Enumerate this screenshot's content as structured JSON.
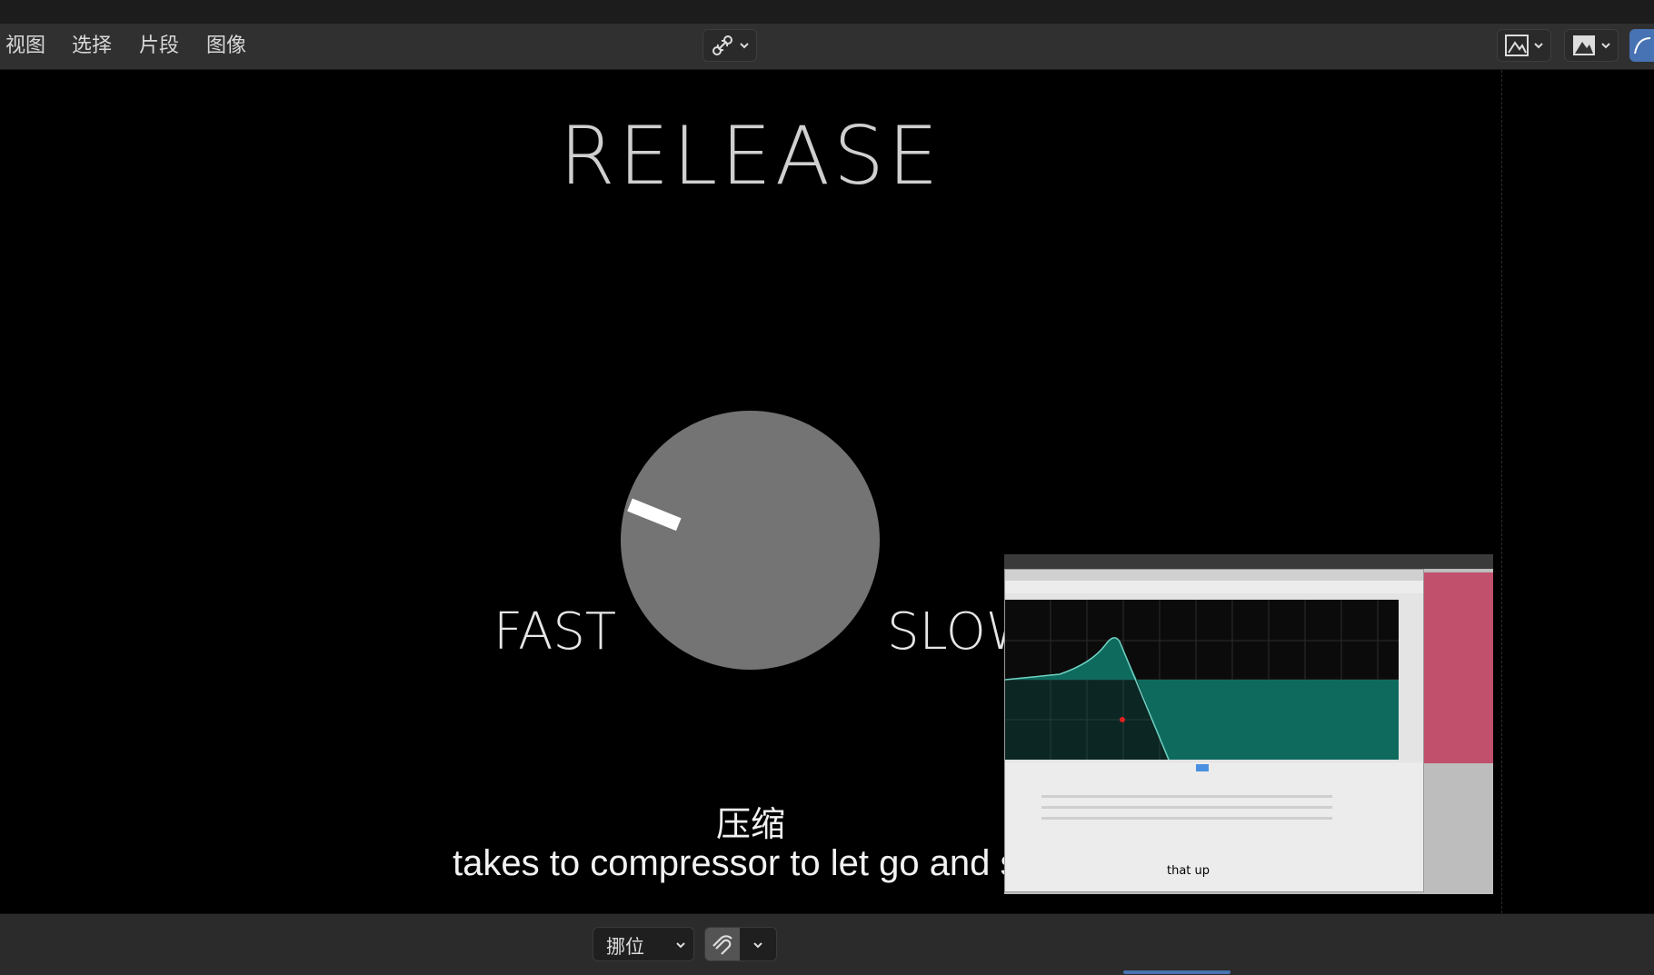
{
  "menu": {
    "items": [
      {
        "label": "视图"
      },
      {
        "label": "选择"
      },
      {
        "label": "片段"
      },
      {
        "label": "图像"
      }
    ]
  },
  "toolbar_icons": {
    "center": "link-icon",
    "right": [
      "image-icon",
      "image-dark-icon",
      "curve-icon"
    ]
  },
  "video": {
    "title": "RELEASE",
    "left_label": "FAST",
    "right_label": "SLOW",
    "subtitle_cn": "压缩",
    "subtitle_en": "takes to compressor to let go and st",
    "pip_caption": "that up",
    "knob_color": "#747474"
  },
  "bottom": {
    "pivot_label": "挪位",
    "snap_icon": "magnet-icon"
  },
  "colors": {
    "accent": "#4772b3",
    "eq_fill": "#0f6a5e",
    "clip_pink": "#c0506b"
  }
}
